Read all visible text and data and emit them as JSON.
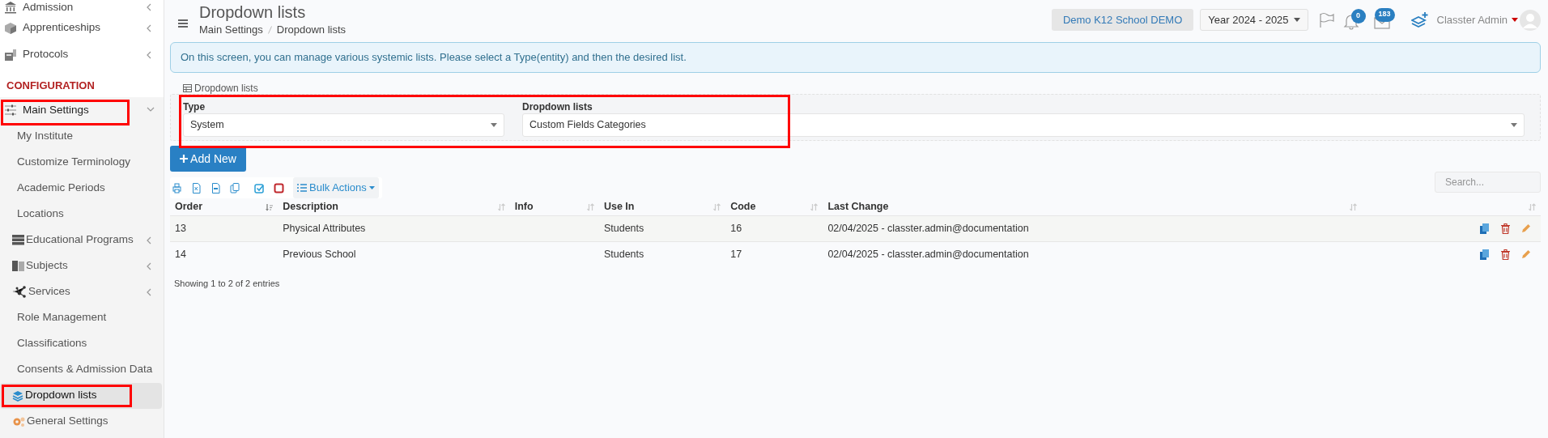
{
  "sidebar": {
    "items": [
      {
        "kind": "item",
        "label": "Admission",
        "has_submenu": true,
        "expanded": false
      },
      {
        "kind": "item",
        "label": "Apprenticeships",
        "has_submenu": true,
        "expanded": false
      },
      {
        "kind": "item",
        "label": "Protocols",
        "has_submenu": true,
        "expanded": false
      },
      {
        "kind": "section",
        "label": "CONFIGURATION"
      },
      {
        "kind": "item",
        "label": "Main Settings",
        "has_submenu": true,
        "expanded": true,
        "children": [
          {
            "label": "My Institute",
            "has_submenu": false,
            "selected": false
          },
          {
            "label": "Customize Terminology",
            "has_submenu": false,
            "selected": false
          },
          {
            "label": "Academic Periods",
            "has_submenu": false,
            "selected": false
          },
          {
            "label": "Locations",
            "has_submenu": false,
            "selected": false
          },
          {
            "label": "Educational Programs",
            "has_submenu": true,
            "selected": false
          },
          {
            "label": "Subjects",
            "has_submenu": true,
            "selected": false
          },
          {
            "label": "Services",
            "has_submenu": true,
            "selected": false
          },
          {
            "label": "Role Management",
            "has_submenu": false,
            "selected": false
          },
          {
            "label": "Classifications",
            "has_submenu": false,
            "selected": false
          },
          {
            "label": "Consents & Admission Data",
            "has_submenu": false,
            "selected": false
          },
          {
            "label": "Dropdown lists",
            "has_submenu": false,
            "selected": true
          },
          {
            "label": "General Settings",
            "has_submenu": false,
            "selected": false
          }
        ]
      }
    ]
  },
  "header": {
    "title": "Dropdown lists",
    "breadcrumbs": [
      "Main Settings",
      "Dropdown lists"
    ],
    "school": "Demo K12 School DEMO",
    "year": "Year 2024 - 2025",
    "notifications": "0",
    "messages": "183",
    "user": "Classter Admin"
  },
  "info": "On this screen, you can manage various systemic lists. Please select a Type(entity) and then the desired list.",
  "filters": {
    "legend": "Dropdown lists",
    "fields": [
      {
        "label": "Type",
        "value": "System"
      },
      {
        "label": "Dropdown lists",
        "value": "Custom Fields Categories"
      }
    ]
  },
  "add_button": "Add New",
  "bulk_actions": "Bulk Actions",
  "search": {
    "placeholder": "Search..."
  },
  "table": {
    "columns": [
      {
        "label": "Order",
        "sorted": true
      },
      {
        "label": "Description",
        "sorted": false
      },
      {
        "label": "Info",
        "sorted": false
      },
      {
        "label": "Use In",
        "sorted": false
      },
      {
        "label": "Code",
        "sorted": false
      },
      {
        "label": "Last Change",
        "sorted": false
      },
      {
        "sorted": false
      }
    ],
    "rows": [
      [
        "13",
        "Physical Attributes",
        "",
        "Students",
        "16",
        "02/04/2025 - classter.admin@documentation"
      ],
      [
        "14",
        "Previous School",
        "",
        "Students",
        "17",
        "02/04/2025 - classter.admin@documentation"
      ]
    ]
  },
  "footer": "Showing 1 to 2 of 2 entries"
}
